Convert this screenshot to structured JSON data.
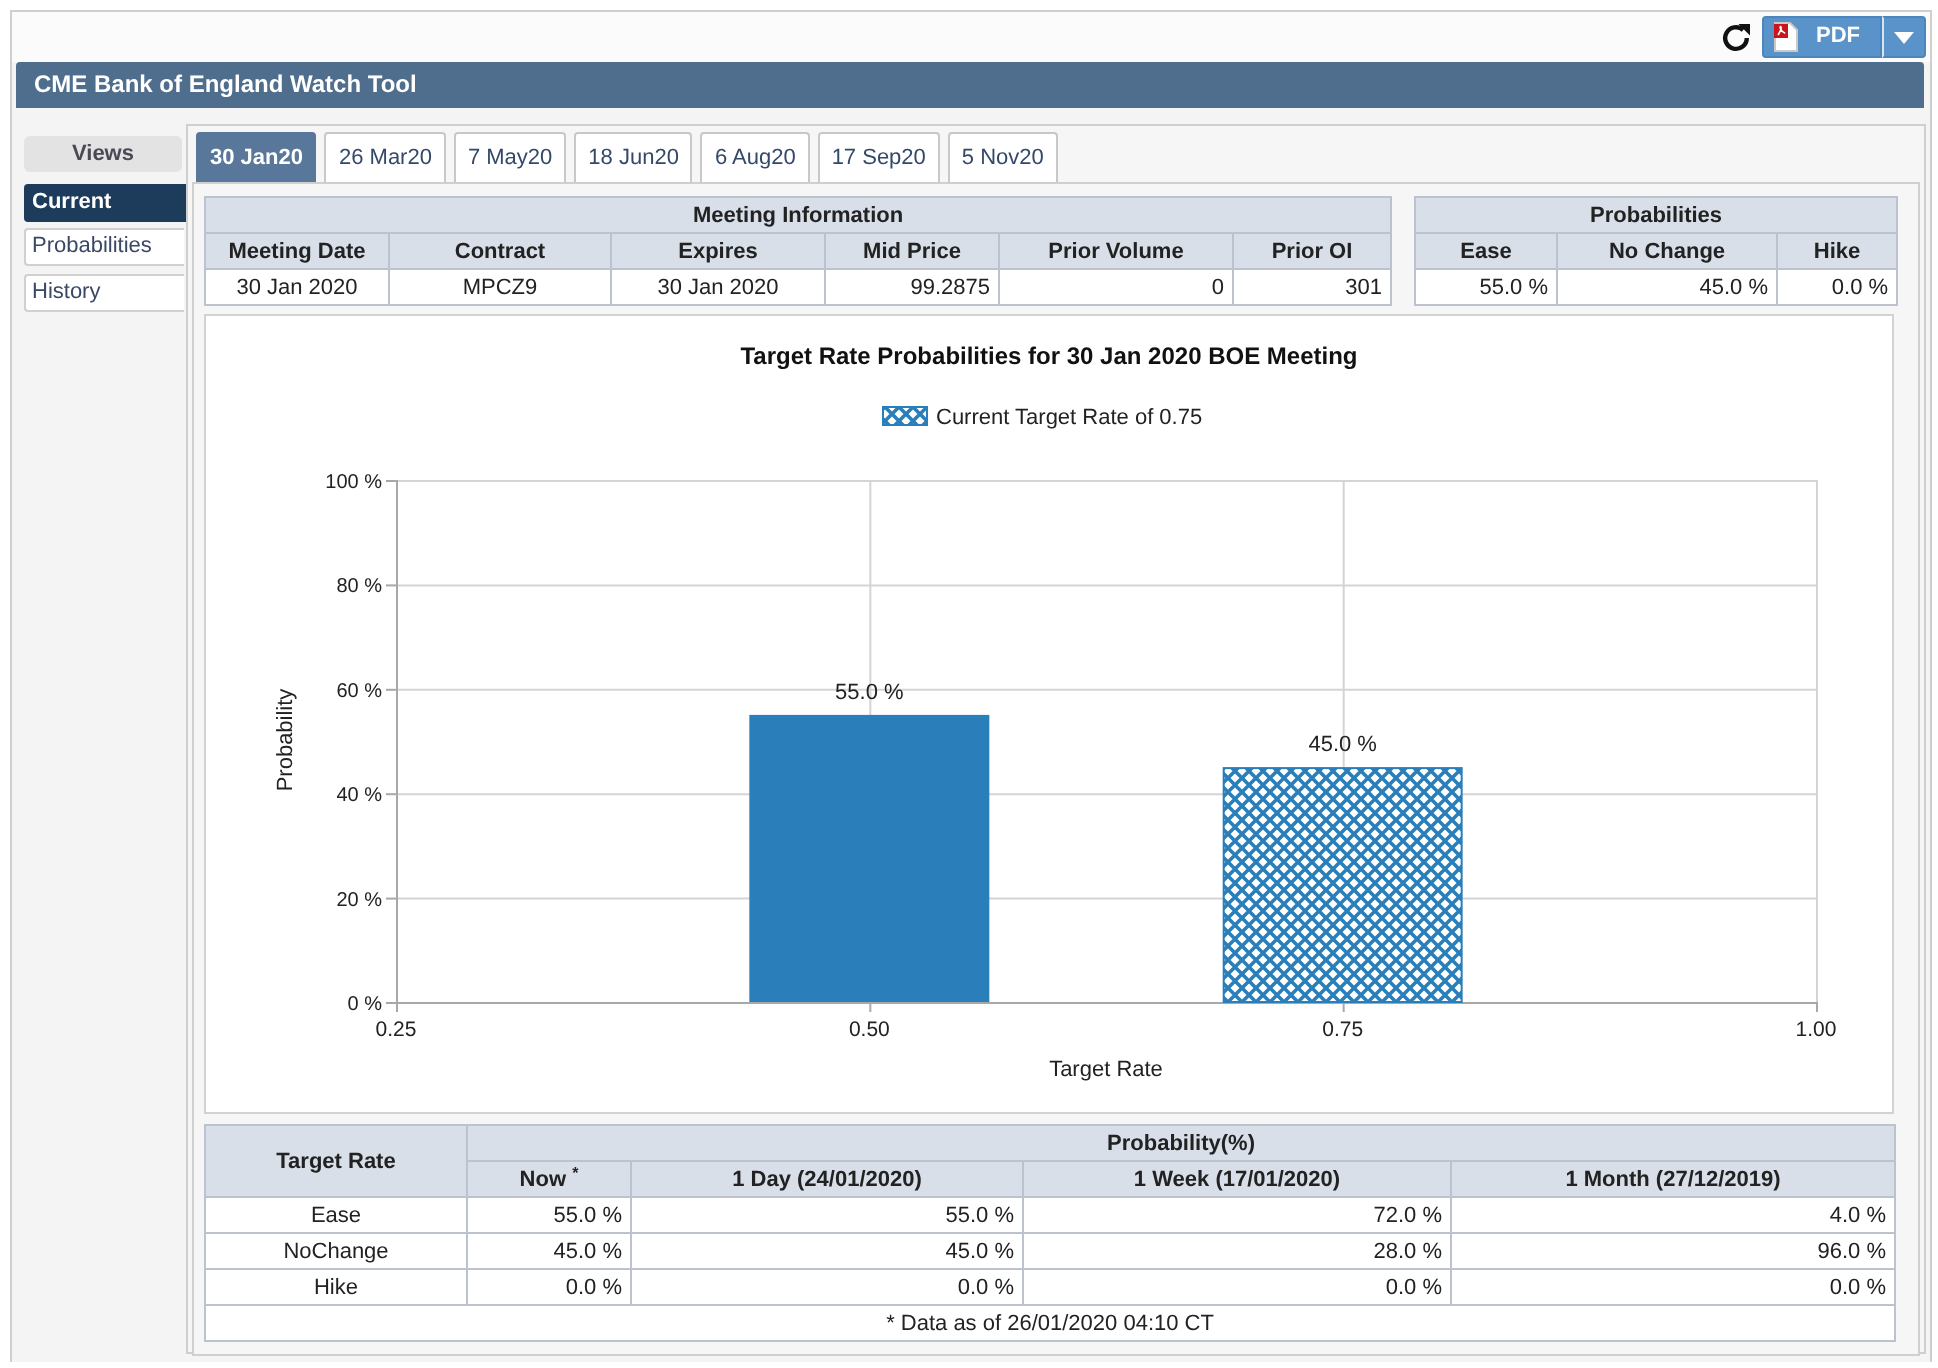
{
  "toolbar": {
    "export_button": {
      "label": "PDF"
    }
  },
  "app": {
    "title": "CME Bank of England Watch Tool"
  },
  "sidebar": {
    "header": "Views",
    "items": [
      {
        "label": "Current",
        "selected": true
      },
      {
        "label": "Probabilities",
        "selected": false
      },
      {
        "label": "History",
        "selected": false
      }
    ]
  },
  "tabs": [
    {
      "label": "30 Jan20",
      "selected": true
    },
    {
      "label": "26 Mar20",
      "selected": false
    },
    {
      "label": "7 May20",
      "selected": false
    },
    {
      "label": "18 Jun20",
      "selected": false
    },
    {
      "label": "6 Aug20",
      "selected": false
    },
    {
      "label": "17 Sep20",
      "selected": false
    },
    {
      "label": "5 Nov20",
      "selected": false
    }
  ],
  "meeting_information": {
    "title": "Meeting Information",
    "columns": [
      "Meeting Date",
      "Contract",
      "Expires",
      "Mid Price",
      "Prior Volume",
      "Prior OI"
    ],
    "rows": [
      [
        "30 Jan 2020",
        "MPCZ9",
        "30 Jan 2020",
        "99.2875",
        "0",
        "301"
      ]
    ]
  },
  "probabilities": {
    "title": "Probabilities",
    "columns": [
      "Ease",
      "No Change",
      "Hike"
    ],
    "rows": [
      [
        "55.0 %",
        "45.0 %",
        "0.0 %"
      ]
    ]
  },
  "chart": {
    "series_styles": [
      {
        "kind": "solid"
      },
      {
        "kind": "hatched"
      }
    ],
    "chart_data": {
      "type": "bar",
      "title": "Target Rate Probabilities for 30 Jan 2020 BOE Meeting",
      "xlabel": "Target Rate",
      "ylabel": "Probability",
      "x": [
        0.5,
        0.75
      ],
      "series": [
        {
          "color": "#2a7fba",
          "values": [
            55,
            null
          ]
        },
        {
          "name": "Current Target Rate of 0.75",
          "color": "#2a7fba",
          "values": [
            null,
            45
          ]
        }
      ],
      "xlim": [
        0.25,
        1
      ],
      "ylim": [
        0,
        100
      ],
      "xticks": [
        {
          "value": 0.25,
          "label": "0.25"
        },
        {
          "value": 0.5,
          "label": "0.50"
        },
        {
          "value": 0.75,
          "label": "0.75"
        },
        {
          "value": 1,
          "label": "1.00"
        }
      ],
      "yticks": [
        {
          "value": 0,
          "label": "0 %"
        },
        {
          "value": 20,
          "label": "20 %"
        },
        {
          "value": 40,
          "label": "40 %"
        },
        {
          "value": 60,
          "label": "60 %"
        },
        {
          "value": 80,
          "label": "80 %"
        },
        {
          "value": 100,
          "label": "100 %"
        }
      ],
      "grid": true,
      "value_labels": [
        "55.0 %",
        "45.0 %"
      ]
    }
  },
  "history": {
    "row_header": "Target Rate",
    "group_header": "Probability(%)",
    "columns": [
      "Now $^{*}$",
      "1 Day (24/01/2020)",
      "1 Week (17/01/2020)",
      "1 Month (27/12/2019)"
    ],
    "rows": [
      {
        "label": "Ease",
        "values": [
          "55.0 %",
          "55.0 %",
          "72.0 %",
          "4.0 %"
        ]
      },
      {
        "label": "NoChange",
        "values": [
          "45.0 %",
          "45.0 %",
          "28.0 %",
          "96.0 %"
        ]
      },
      {
        "label": "Hike",
        "values": [
          "0.0 %",
          "0.0 %",
          "0.0 %",
          "0.0 %"
        ]
      }
    ],
    "footnote": "* Data as of 26/01/2020 04:10 CT"
  }
}
